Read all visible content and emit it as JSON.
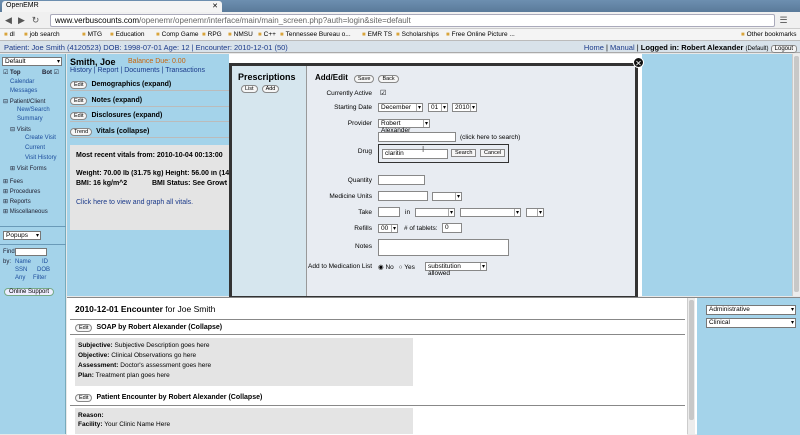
{
  "browser": {
    "tab_title": "OpenEMR",
    "url_host": "www.verbuscounts.com",
    "url_path": "/openemr/openemr/interface/main/main_screen.php?auth=login&site=default",
    "bookmarks": [
      "dl",
      "job search",
      "MTG",
      "Education",
      "Comp Game",
      "RPG",
      "NMSU",
      "C++",
      "Tennessee Bureau o...",
      "EMR TS",
      "Scholarships",
      "Free Online Picture ..."
    ],
    "other_bookmarks": "Other bookmarks"
  },
  "header": {
    "patient_info": "Patient: Joe Smith (4120523) DOB: 1998-07-01 Age: 12 | Encounter: 2010-12-01 (50)",
    "home": "Home",
    "manual": "Manual",
    "logged_in": "Logged in: Robert Alexander",
    "default_tag": "(Default)",
    "logout": "Logout"
  },
  "leftnav": {
    "select_value": "Default",
    "top_label": "Top",
    "bot_label": "Bot",
    "items": {
      "calendar": "Calendar",
      "messages": "Messages",
      "patient_client": "Patient/Client",
      "new_search": "New/Search",
      "summary": "Summary",
      "visits": "Visits",
      "create_visit": "Create Visit",
      "current": "Current",
      "visit_history": "Visit History",
      "visit_forms": "Visit Forms",
      "fees": "Fees",
      "procedures": "Procedures",
      "reports": "Reports",
      "miscellaneous": "Miscellaneous"
    },
    "popups": "Popups",
    "find": "Find:",
    "by": "by:",
    "name": "Name",
    "id": "ID",
    "ssn": "SSN",
    "dob": "DOB",
    "any": "Any",
    "filter": "Filter",
    "online_support": "Online Support"
  },
  "patient": {
    "name": "Smith, Joe",
    "balance": "Balance Due: 0.00",
    "links": "History | Report | Documents | Transactions",
    "edit": "Edit",
    "trend": "Trend",
    "sections": {
      "demographics": "Demographics (expand)",
      "notes": "Notes (expand)",
      "disclosures": "Disclosures (expand)",
      "vitals": "Vitals (collapse)"
    },
    "vitals": {
      "recent": "Most recent vitals from: 2010-10-04 00:13:00",
      "weight": "Weight: 70.00 lb (31.75 kg) Height: 56.00 in (142.2",
      "bmi": "BMI: 16 kg/m^2",
      "bmi_status": "BMI Status: See Growt",
      "graph_link": "Click here to view and graph all vitals."
    }
  },
  "dialog": {
    "title": "Prescriptions",
    "list_btn": "List",
    "add_btn": "Add",
    "addedit": "Add/Edit",
    "save_btn": "Save",
    "back_btn": "Back",
    "labels": {
      "currently_active": "Currently Active",
      "starting_date": "Starting Date",
      "provider": "Provider",
      "drug": "Drug",
      "quantity": "Quantity",
      "medicine_units": "Medicine Units",
      "take": "Take",
      "refills": "Refills",
      "notes": "Notes",
      "add_to_med_list": "Add to Medication List"
    },
    "start_month": "December",
    "start_day": "01",
    "start_year": "2010",
    "provider_value": "Robert Alexander",
    "click_to_search": "(click here to search)",
    "drug_search_value": "claritin",
    "search_btn": "Search",
    "cancel_btn": "Cancel",
    "in_label": "in",
    "refills_value": "00",
    "tablets_label": "# of tablets:",
    "tablets_value": "0",
    "no_label": "No",
    "yes_label": "Yes",
    "substitution": "substitution allowed"
  },
  "encounter": {
    "title_date": "2010-12-01 Encounter",
    "title_for": "for Joe Smith",
    "edit": "Edit",
    "soap_header": "SOAP by Robert Alexander (Collapse)",
    "soap": [
      {
        "label": "Subjective:",
        "value": "Subjective Description goes here"
      },
      {
        "label": "Objective:",
        "value": "Clinical Observations go here"
      },
      {
        "label": "Assessment:",
        "value": "Doctor's assessment goes here"
      },
      {
        "label": "Plan:",
        "value": "Treatment plan goes here"
      }
    ],
    "pe_header": "Patient Encounter by Robert Alexander (Collapse)",
    "reason": "Reason:",
    "facility_label": "Facility:",
    "facility_value": "Your Clinic Name Here",
    "right_select1": "Administrative",
    "right_select2": "Clinical"
  }
}
